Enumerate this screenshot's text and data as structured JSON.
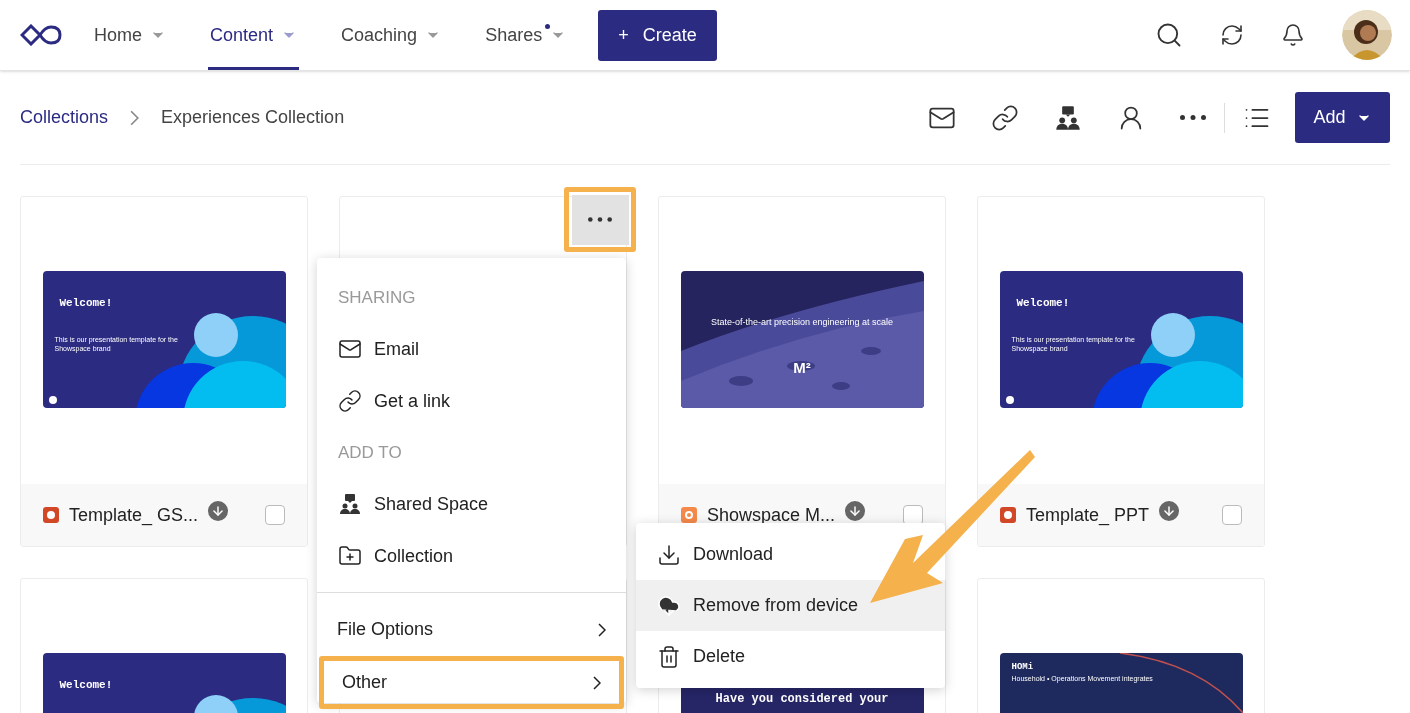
{
  "nav": {
    "items": [
      {
        "label": "Home",
        "selected": false,
        "dot": false
      },
      {
        "label": "Content",
        "selected": true,
        "dot": false
      },
      {
        "label": "Coaching",
        "selected": false,
        "dot": false
      },
      {
        "label": "Shares",
        "selected": false,
        "dot": true
      }
    ],
    "create_button": {
      "icon": "+",
      "label": "Create"
    }
  },
  "breadcrumb": [
    {
      "label": "Collections",
      "kind": "link"
    },
    {
      "label": "Experiences Collection",
      "kind": "current"
    }
  ],
  "add_button": "Add",
  "cards": [
    {
      "title": "Template_ GS...",
      "kind": "slides",
      "checked": false,
      "thumbnail": {
        "kind": "welcome",
        "title": "Welcome!",
        "subtitle": "This is our presentation template for the Showspace brand"
      }
    },
    {
      "menu_open": true,
      "thumbnail": {
        "kind": "hidden"
      }
    },
    {
      "title": "Showspace M...",
      "kind": "google",
      "checked": false,
      "thumbnail": {
        "kind": "moon",
        "title": "State-of-the-art precision engineering at scale",
        "mark": "M²"
      }
    },
    {
      "title": "Template_ PPT",
      "kind": "slides",
      "checked": false,
      "thumbnail": {
        "kind": "welcome",
        "title": "Welcome!",
        "subtitle": "This is our presentation template for the Showspace brand"
      }
    },
    {
      "thumbnail": {
        "kind": "welcome",
        "title": "Welcome!"
      }
    },
    {
      "thumbnail": {
        "kind": "hidden"
      }
    },
    {
      "thumbnail": {
        "kind": "space",
        "title": "Have you considered your"
      }
    },
    {
      "thumbnail": {
        "kind": "homi",
        "title": "HOMi",
        "subtitle": "Household • Operations Movement integrates"
      }
    }
  ],
  "menu": [
    {
      "kind": "header",
      "label": "SHARING"
    },
    {
      "kind": "mail",
      "label": "Email"
    },
    {
      "kind": "link",
      "label": "Get a link"
    },
    {
      "kind": "header",
      "label": "ADD TO"
    },
    {
      "kind": "space",
      "label": "Shared Space"
    },
    {
      "kind": "collection",
      "label": "Collection"
    },
    {
      "kind": "divider"
    },
    {
      "kind": "submenu",
      "label": "File Options",
      "highlighted": false
    },
    {
      "kind": "submenu",
      "label": "Other",
      "highlighted": true
    }
  ],
  "submenu": [
    {
      "kind": "download",
      "label": "Download",
      "hovered": false
    },
    {
      "kind": "cloud",
      "label": "Remove from device",
      "hovered": true
    },
    {
      "kind": "trash",
      "label": "Delete",
      "hovered": false
    }
  ]
}
